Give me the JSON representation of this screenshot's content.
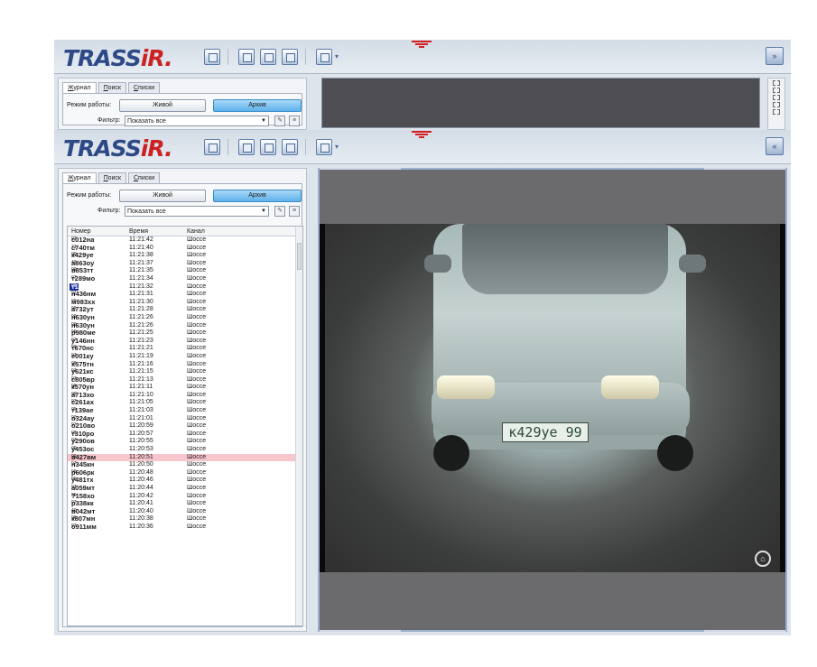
{
  "logo": {
    "text": "TRASS",
    "accent": "iR",
    "dot": "."
  },
  "tabs": [
    {
      "label": "Журнал",
      "u": "Ж",
      "rest": "урнал"
    },
    {
      "label": "Поиск",
      "u": "П",
      "rest": "оиск"
    },
    {
      "label": "Списки",
      "u": "С",
      "rest": "писки"
    }
  ],
  "mode": {
    "label": "Режим работы:",
    "live": "Живой",
    "archive": "Архив"
  },
  "filter": {
    "label": "Фильтр:",
    "value": "Показать все"
  },
  "columns": {
    "number": "Номер",
    "time": "Время",
    "channel": "Канал"
  },
  "rows_top": [
    {
      "num": "с012на",
      "region": "97",
      "time": "11:21:42",
      "channel": "Шоссе"
    },
    {
      "num": "с740тм",
      "region": "71",
      "time": "11:21:40",
      "channel": "Шоссе"
    },
    {
      "num": "к429уе",
      "region": "99",
      "time": "11:21:38",
      "channel": "Шоссе"
    },
    {
      "num": "а863оу",
      "region": "40",
      "time": "11:21:37",
      "channel": "Шоссе"
    },
    {
      "num": "в853тт",
      "region": "99",
      "time": "11:21:35",
      "channel": "Шоссе"
    },
    {
      "num": "т289мо",
      "region": "97",
      "time": "11:21:34",
      "channel": "Шоссе"
    },
    {
      "num": "т1324",
      "region": "99",
      "time": "11:21:32",
      "channel": "Шоссе"
    },
    {
      "num": "н436нм",
      "region": "97",
      "time": "11:21:31",
      "channel": "Шоссе"
    },
    {
      "num": "м983хх",
      "region": "99",
      "time": "11:21:30",
      "channel": "Шоссе"
    },
    {
      "num": "а732ут",
      "region": "99",
      "time": "11:21:28",
      "channel": "Шоссе"
    },
    {
      "num": "н630ун",
      "region": "99",
      "time": "11:21:26",
      "channel": "Шоссе"
    },
    {
      "num": "н630ун",
      "region": "99",
      "time": "11:21:26",
      "channel": "Шоссе"
    },
    {
      "num": "р980ме",
      "region": "99",
      "time": "11:21:25",
      "channel": "Шоссе"
    },
    {
      "num": "у146нн",
      "region": "97",
      "time": "11:21:23",
      "channel": "Шоссе"
    },
    {
      "num": "т670нс",
      "region": "90",
      "time": "11:21:21",
      "channel": "Шоссе"
    },
    {
      "num": "е001ку",
      "region": "97",
      "time": "11:21:19",
      "channel": "Шоссе"
    },
    {
      "num": "х575тн",
      "region": "99",
      "time": "11:21:16",
      "channel": "Шоссе"
    },
    {
      "num": "у621кс",
      "region": "97",
      "time": "11:21:15",
      "channel": "Шоссе"
    },
    {
      "num": "с805вр",
      "region": "97",
      "time": "11:21:13",
      "channel": "Шоссе"
    },
    {
      "num": "к570ун",
      "region": "99",
      "time": "11:21:11",
      "channel": "Шоссе"
    },
    {
      "num": "а713хо",
      "region": "99",
      "time": "11:21:10",
      "channel": "Шоссе"
    },
    {
      "num": "с261ах",
      "region": "97",
      "time": "11:21:05",
      "channel": "Шоссе"
    },
    {
      "num": "т139ае",
      "region": "99",
      "time": "11:21:03",
      "channel": "Шоссе"
    },
    {
      "num": "о324ау",
      "region": "90",
      "time": "11:21:01",
      "channel": "Шоссе"
    },
    {
      "num": "о210во",
      "region": "97",
      "time": "11:20:59",
      "channel": "Шоссе"
    },
    {
      "num": "т310ро",
      "region": "99",
      "time": "11:20:57",
      "channel": "Шоссе"
    },
    {
      "num": "у290ов",
      "region": "97",
      "time": "11:20:55",
      "channel": "Шоссе"
    },
    {
      "num": "у453ос",
      "region": "99",
      "time": "11:20:53",
      "channel": "Шоссе"
    },
    {
      "num": "в427вм",
      "region": "99",
      "time": "11:20:51",
      "channel": "Шоссе"
    },
    {
      "num": "н345кн",
      "region": "97",
      "time": "11:20:50",
      "channel": "Шоссе"
    },
    {
      "num": "р606рк",
      "region": "99",
      "time": "11:20:48",
      "channel": "Шоссе"
    },
    {
      "num": "у481тх",
      "region": "99",
      "time": "11:20:46",
      "channel": "Шоссе"
    },
    {
      "num": "а059мт",
      "region": "97",
      "time": "11:20:44",
      "channel": "Шоссе"
    },
    {
      "num": "?158хо",
      "region": "99",
      "time": "11:20:42",
      "channel": "Шоссе"
    },
    {
      "num": "р338кк",
      "region": "97",
      "time": "11:20:41",
      "channel": "Шоссе"
    },
    {
      "num": "в042мт",
      "region": "40",
      "time": "11:20:40",
      "channel": "Шоссе"
    },
    {
      "num": "к807мн",
      "region": "99",
      "time": "11:20:38",
      "channel": "Шоссе"
    },
    {
      "num": "о911мм",
      "region": "97",
      "time": "11:20:36",
      "channel": "Шоссе"
    }
  ],
  "selected_blue_index": 6,
  "selected_pink_index": 28,
  "blue_arrow_index": 11,
  "plate_text": "к429уе 99",
  "colors": {
    "brand_blue": "#2e4a86",
    "brand_red": "#cc2222",
    "archive_active": "#5eb2ec",
    "selection_pink": "#f7c6cd",
    "selection_blue": "#1c2f9c"
  },
  "icons": [
    "journal-icon",
    "edit-icon",
    "list-icon",
    "image-icon",
    "layout-icon",
    "camera-panel-icon"
  ]
}
